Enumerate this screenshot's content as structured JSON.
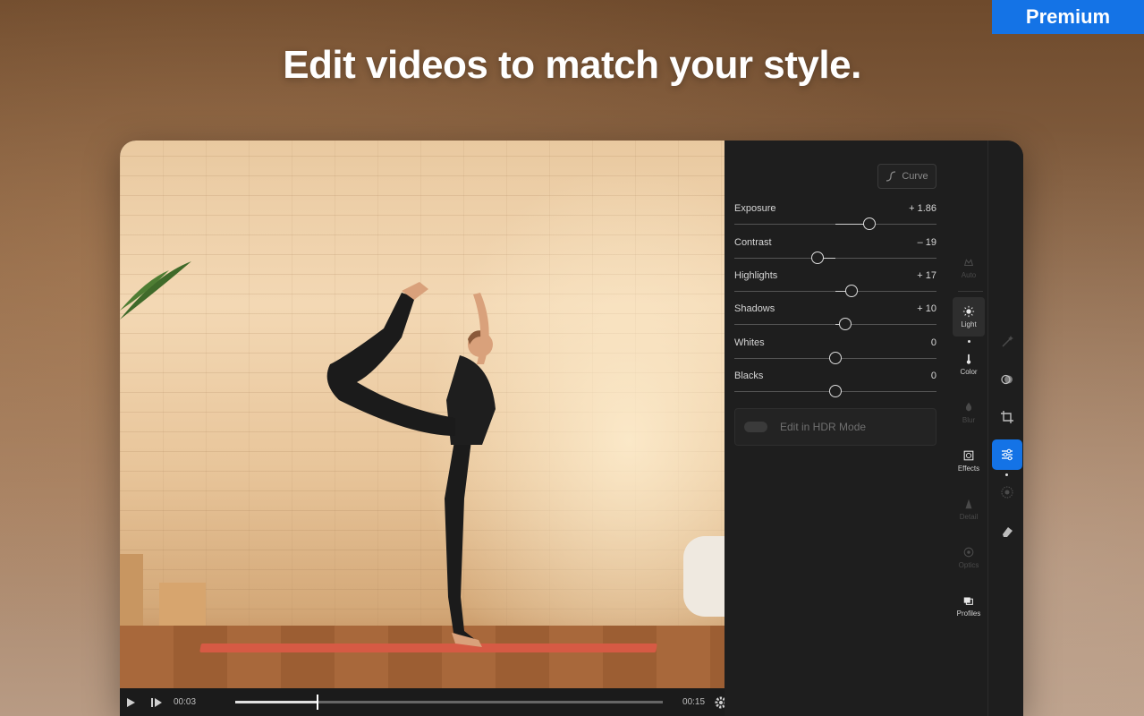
{
  "banner": {
    "premium_label": "Premium"
  },
  "headline": "Edit videos to match your style.",
  "video": {
    "current_time": "00:03",
    "duration": "00:15",
    "progress": 0.19
  },
  "panel": {
    "curve_label": "Curve",
    "sliders": [
      {
        "label": "Exposure",
        "value": "+ 1.86",
        "position": 0.67
      },
      {
        "label": "Contrast",
        "value": "– 19",
        "position": 0.41
      },
      {
        "label": "Highlights",
        "value": "+ 17",
        "position": 0.58
      },
      {
        "label": "Shadows",
        "value": "+ 10",
        "position": 0.55
      },
      {
        "label": "Whites",
        "value": "0",
        "position": 0.5
      },
      {
        "label": "Blacks",
        "value": "0",
        "position": 0.5
      }
    ],
    "hdr_label": "Edit in HDR Mode"
  },
  "tools": [
    {
      "label": "Auto",
      "icon": "auto-icon",
      "state": "dim"
    },
    {
      "label": "Light",
      "icon": "sun-icon",
      "state": "active"
    },
    {
      "label": "Color",
      "icon": "thermometer-icon",
      "state": "normal"
    },
    {
      "label": "Blur",
      "icon": "drop-icon",
      "state": "dim"
    },
    {
      "label": "Effects",
      "icon": "effects-icon",
      "state": "normal"
    },
    {
      "label": "Detail",
      "icon": "triangle-icon",
      "state": "dim"
    },
    {
      "label": "Optics",
      "icon": "lens-icon",
      "state": "dim"
    },
    {
      "label": "Profiles",
      "icon": "profiles-icon",
      "state": "normal"
    }
  ],
  "rail": [
    {
      "icon": "wand-icon",
      "state": "dim"
    },
    {
      "icon": "masking-icon",
      "state": "normal"
    },
    {
      "icon": "crop-icon",
      "state": "normal"
    },
    {
      "icon": "adjust-sliders-icon",
      "state": "active"
    },
    {
      "icon": "heal-icon",
      "state": "dim"
    },
    {
      "icon": "eraser-icon",
      "state": "normal"
    }
  ],
  "colors": {
    "accent": "#1473e6",
    "panel_bg": "#1e1e1e"
  }
}
